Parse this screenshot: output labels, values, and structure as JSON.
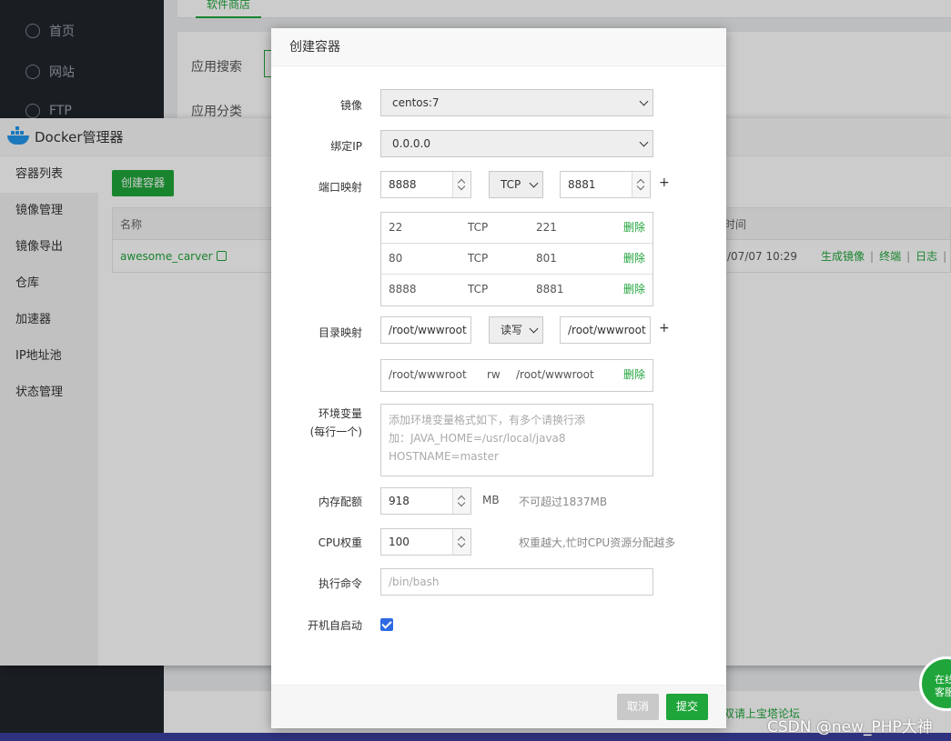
{
  "background": {
    "nav": [
      {
        "label": "首页"
      },
      {
        "label": "网站"
      },
      {
        "label": "FTP"
      }
    ],
    "tab_label": "软件商店",
    "filters": [
      "应用搜索",
      "应用分类"
    ],
    "forum_text": "双请上宝塔论坛"
  },
  "docker": {
    "title": "Docker管理器",
    "sidebar": [
      "容器列表",
      "镜像管理",
      "镜像导出",
      "仓库",
      "加速器",
      "IP地址池",
      "状态管理"
    ],
    "create_button": "创建容器",
    "table": {
      "col_name": "名称",
      "col_time": "时间",
      "rows": [
        {
          "name": "awesome_carver",
          "time": "/07/07 10:29",
          "ops": [
            "生成镜像",
            "终端",
            "日志"
          ]
        }
      ]
    }
  },
  "modal": {
    "title": "创建容器",
    "image": {
      "label": "镜像",
      "value": "centos:7"
    },
    "bind_ip": {
      "label": "绑定IP",
      "value": "0.0.0.0"
    },
    "port_map": {
      "label": "端口映射",
      "host_port": "8888",
      "protocol": "TCP",
      "container_port": "8881",
      "add": "+",
      "entries": [
        {
          "host": "22",
          "proto": "TCP",
          "container": "221",
          "del": "删除"
        },
        {
          "host": "80",
          "proto": "TCP",
          "container": "801",
          "del": "删除"
        },
        {
          "host": "8888",
          "proto": "TCP",
          "container": "8881",
          "del": "删除"
        }
      ]
    },
    "dir_map": {
      "label": "目录映射",
      "host_dir": "/root/wwwroot",
      "mode": "读写",
      "container_dir": "/root/wwwroot",
      "add": "+",
      "entries": [
        {
          "host": "/root/wwwroot",
          "mode": "rw",
          "container": "/root/wwwroot",
          "del": "删除"
        }
      ]
    },
    "env": {
      "label_line1": "环境变量",
      "label_line2": "(每行一个)",
      "placeholder": "添加环境变量格式如下，有多个请换行添\n加：JAVA_HOME=/usr/local/java8\nHOSTNAME=master"
    },
    "memory": {
      "label": "内存配额",
      "value": "918",
      "unit": "MB",
      "hint": "不可超过1837MB"
    },
    "cpu": {
      "label": "CPU权重",
      "value": "100",
      "hint": "权重越大,忙时CPU资源分配越多"
    },
    "command": {
      "label": "执行命令",
      "placeholder": "/bin/bash"
    },
    "autostart": {
      "label": "开机自启动",
      "checked": true
    },
    "cancel": "取消",
    "submit": "提交"
  },
  "chat_bubble": "在线\n客服",
  "watermark": "CSDN @new_PHP大神"
}
